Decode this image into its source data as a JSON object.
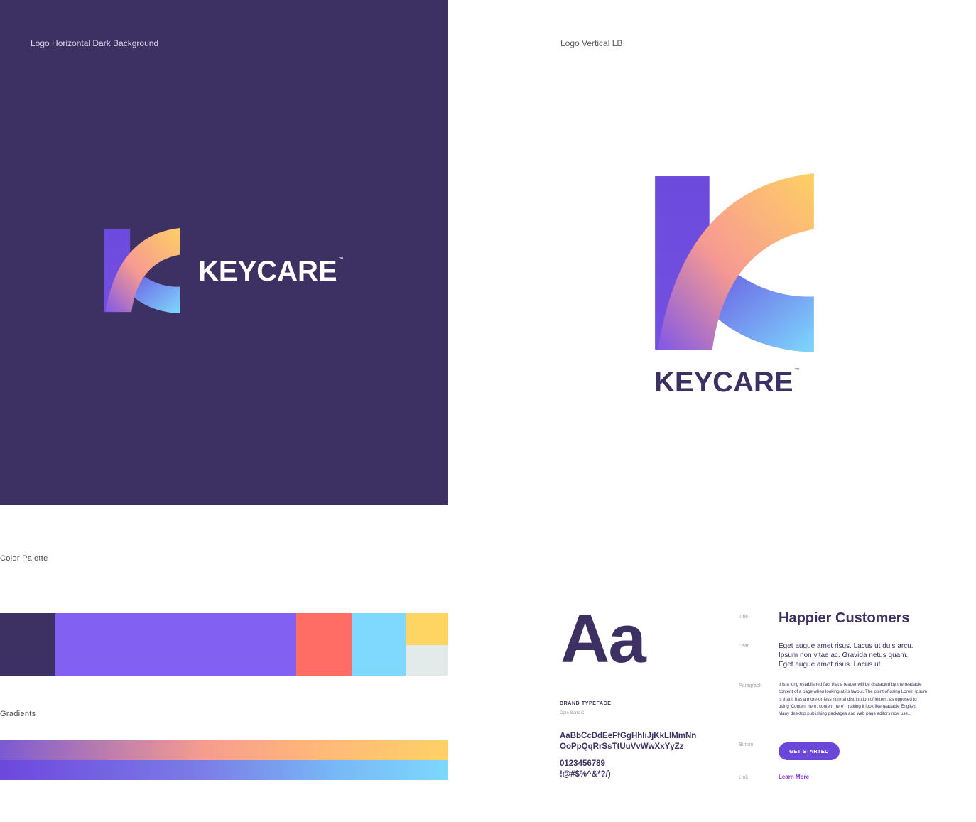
{
  "sections": {
    "horizontal_dark": {
      "caption": "Logo Horizontal Dark Background"
    },
    "vertical_light": {
      "caption": "Logo Vertical LB"
    },
    "palette": {
      "caption": "Color Palette"
    },
    "gradients": {
      "caption": "Gradients"
    }
  },
  "brand": {
    "name": "KEYCARE",
    "trademark": "™"
  },
  "colors": {
    "dark_bg": "#3d3062",
    "palette": [
      "#3d3062",
      "#8260f1",
      "#ff6d65",
      "#7fd8fd",
      "#fed563",
      "#e3eaea"
    ],
    "gradient_warm": [
      "#7b5ad2",
      "#f59c8f",
      "#fed166"
    ],
    "gradient_cool": [
      "#6d47de",
      "#7b7de6",
      "#7dd8fd"
    ]
  },
  "typography": {
    "specimen": "Aa",
    "typeface_label": "BRAND TYPEFACE",
    "typeface_name": "Core Sans C",
    "alphabet_line1": "AaBbCcDdEeFfGgHhIiJjKkLlMmNn",
    "alphabet_line2": "OoPpQqRrSsTtUuVvWwXxYyZz",
    "digits": "0123456789",
    "symbols": "!@#$%^&*?/)"
  },
  "specs": {
    "title_label": "Title",
    "title_text": "Happier Customers",
    "lead_label": "Lead",
    "lead_text": "Eget augue amet risus. Lacus ut duis arcu. Ipsum non vitae ac. Gravida netus quam. Eget augue amet risus. Lacus ut.",
    "paragraph_label": "Paragraph",
    "paragraph_text": "It is a long established fact that a reader will be distracted by the readable content of a page when looking at its layout. The point of using Lorem Ipsum is that it has a more-or-less normal distribution of letters, as opposed to using 'Content here, content here', making it look like readable English. Many desktop publishing packages and web page editors now use...",
    "button_label": "Button",
    "button_text": "GET STARTED",
    "link_label": "Link",
    "link_text": "Learn More"
  }
}
